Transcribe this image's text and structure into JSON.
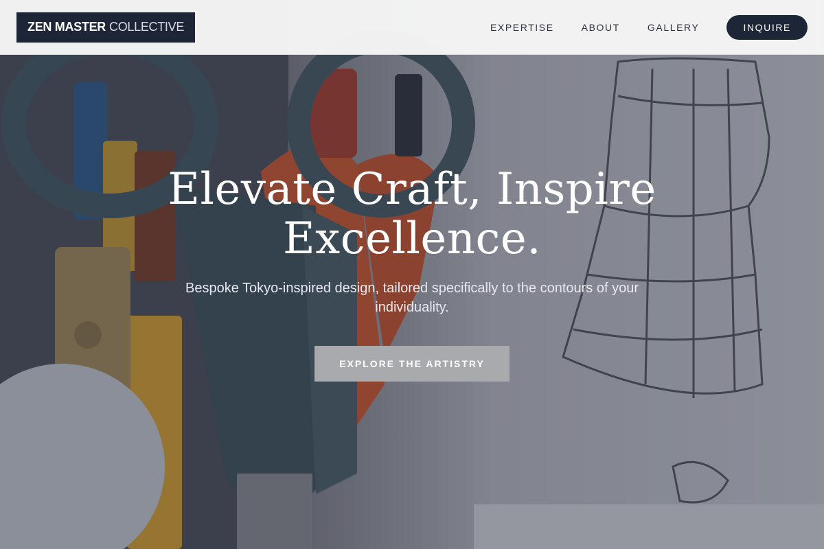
{
  "brand": {
    "name_strong": "ZEN MASTER",
    "name_light": "COLLECTIVE"
  },
  "nav": {
    "links": [
      "EXPERTISE",
      "ABOUT",
      "GALLERY"
    ],
    "cta": "INQUIRE"
  },
  "hero": {
    "headline_line1": "Elevate Craft, Inspire",
    "headline_line2": "Excellence.",
    "subtitle": "Bespoke Tokyo-inspired design, tailored specifically to the contours of your individuality.",
    "cta_label": "EXPLORE THE ARTISTRY",
    "background_image": "scissors-pencils-and-wire-sketch-photo"
  },
  "colors": {
    "navy": "#1c2637",
    "header_bg": "#f6f6f6",
    "cta_gray": "#a9aaad"
  }
}
